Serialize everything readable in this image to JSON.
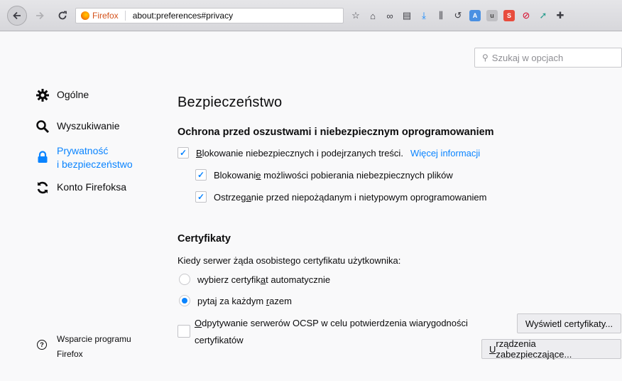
{
  "browser": {
    "identity_label": "Firefox",
    "url": "about:preferences#privacy",
    "toolbar_icons": [
      "star-icon",
      "home-icon",
      "infinity-icon",
      "print-icon",
      "download-icon",
      "library-icon",
      "history-icon",
      "translate-icon",
      "ublock-icon",
      "s-extension-icon",
      "block-extension-icon",
      "arrow-extension-icon",
      "puzzle-icon"
    ]
  },
  "search": {
    "placeholder": "Szukaj w opcjach"
  },
  "sidebar": {
    "items": [
      {
        "icon": "gear-icon",
        "label": "Ogólne"
      },
      {
        "icon": "search-icon",
        "label": "Wyszukiwanie"
      },
      {
        "icon": "lock-icon",
        "label_line1": "Prywatność",
        "label_line2": "i bezpieczeństwo",
        "selected": true
      },
      {
        "icon": "sync-icon",
        "label": "Konto Firefoksa"
      }
    ],
    "support": {
      "icon": "help-icon",
      "label": "Wsparcie programu Firefox"
    }
  },
  "main": {
    "section_title": "Bezpieczeństwo",
    "fraud": {
      "title": "Ochrona przed oszustwami i niebezpiecznym oprogramowaniem",
      "block_dangerous": {
        "prefix": "",
        "ak": "B",
        "rest": "lokowanie niebezpiecznych i podejrzanych treści.",
        "checked": true
      },
      "learn_more": "Więcej informacji",
      "block_downloads": {
        "before": "Blokowani",
        "ak": "e",
        "after": " możliwości pobierania niebezpiecznych plików",
        "checked": true
      },
      "warn_unwanted": {
        "before": "Ostrzeg",
        "ak": "a",
        "after": "nie przed niepożądanym i nietypowym oprogramowaniem",
        "checked": true
      }
    },
    "certs": {
      "title": "Certyfikaty",
      "question": "Kiedy serwer żąda osobistego certyfikatu użytkownika:",
      "auto": {
        "before": "wybierz certyfik",
        "ak": "a",
        "after": "t automatycznie",
        "selected": false
      },
      "ask": {
        "before": "pytaj za każdym ",
        "ak": "r",
        "after": "azem",
        "selected": true
      },
      "ocsp": {
        "ak": "O",
        "line1_rest": "dpytywanie serwerów OCSP w celu potwierdzenia wiarygodności",
        "line2": "certyfikatów",
        "checked": false
      },
      "view_button": "Wyświetl certyfikaty...",
      "devices_button": {
        "ak": "U",
        "rest": "rządzenia zabezpieczające..."
      }
    }
  },
  "colors": {
    "accent": "#0a84ff",
    "text": "#0c0c0d",
    "background": "#f9f9fa"
  }
}
